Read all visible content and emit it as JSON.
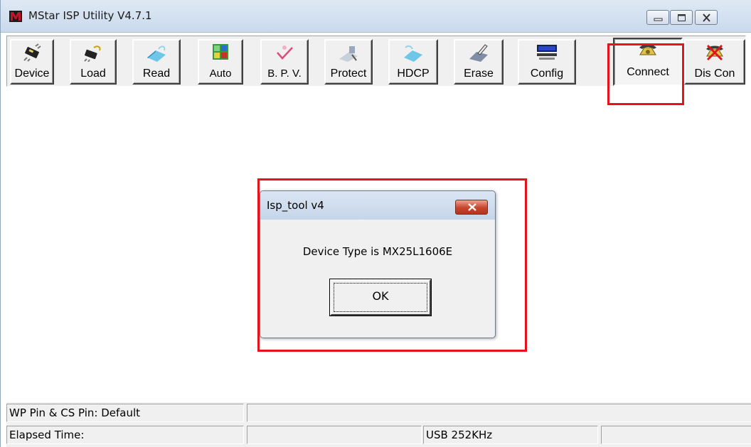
{
  "window": {
    "title": "MStar ISP Utility V4.7.1"
  },
  "toolbar": {
    "buttons": [
      {
        "label": "Device",
        "icon": "chip-icon"
      },
      {
        "label": "Load",
        "icon": "load-chip-icon"
      },
      {
        "label": "Read",
        "icon": "read-icon"
      },
      {
        "label": "Auto",
        "icon": "auto-icon"
      },
      {
        "label": "B. P. V.",
        "icon": "check-icon"
      },
      {
        "label": "Protect",
        "icon": "protect-icon"
      },
      {
        "label": "HDCP",
        "icon": "hdcp-icon"
      },
      {
        "label": "Erase",
        "icon": "erase-icon"
      },
      {
        "label": "Config",
        "icon": "config-icon"
      },
      {
        "label": "Connect",
        "icon": "telephone-icon"
      },
      {
        "label": "Dis Con",
        "icon": "disconnect-icon"
      }
    ]
  },
  "dialog": {
    "title": "Isp_tool v4",
    "message": "Device Type is MX25L1606E",
    "ok_label": "OK"
  },
  "statusbar": {
    "wp_cs": "WP Pin & CS Pin: Default",
    "elapsed": "Elapsed Time:",
    "usb": "USB  252KHz"
  },
  "colors": {
    "highlight": "#e8121c",
    "titlebar": "#c9d9ec",
    "face": "#f0f0f0"
  }
}
